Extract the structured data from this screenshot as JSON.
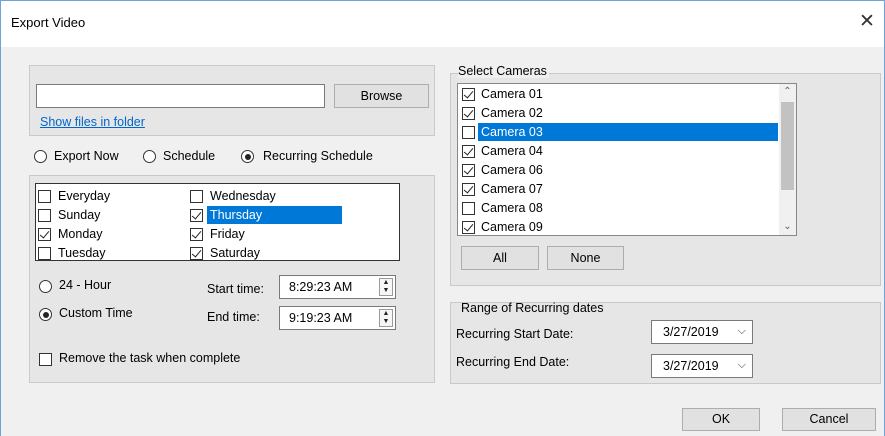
{
  "window": {
    "title": "Export Video",
    "close_glyph": "✕"
  },
  "file": {
    "path_value": "",
    "browse_label": "Browse",
    "show_files_link": "Show files in folder"
  },
  "export_mode": {
    "options": [
      "Export Now",
      "Schedule",
      "Recurring Schedule"
    ],
    "selected": "Recurring Schedule"
  },
  "days": [
    {
      "label": "Everyday",
      "checked": false,
      "selected": false
    },
    {
      "label": "Sunday",
      "checked": false,
      "selected": false
    },
    {
      "label": "Monday",
      "checked": true,
      "selected": false
    },
    {
      "label": "Tuesday",
      "checked": false,
      "selected": false
    },
    {
      "label": "Wednesday",
      "checked": false,
      "selected": false
    },
    {
      "label": "Thursday",
      "checked": true,
      "selected": true
    },
    {
      "label": "Friday",
      "checked": true,
      "selected": false
    },
    {
      "label": "Saturday",
      "checked": true,
      "selected": false
    }
  ],
  "time_mode": {
    "options": [
      "24 - Hour",
      "Custom Time"
    ],
    "selected": "Custom Time"
  },
  "start_time": {
    "label": "Start time:",
    "value": "8:29:23 AM"
  },
  "end_time": {
    "label": "End time:",
    "value": "9:19:23 AM"
  },
  "remove_task": {
    "label": "Remove the task when complete",
    "checked": false
  },
  "cameras": {
    "heading": "Select Cameras",
    "items": [
      {
        "label": "Camera 01",
        "checked": true,
        "selected": false
      },
      {
        "label": "Camera 02",
        "checked": true,
        "selected": false
      },
      {
        "label": "Camera 03",
        "checked": false,
        "selected": true
      },
      {
        "label": "Camera 04",
        "checked": true,
        "selected": false
      },
      {
        "label": "Camera 06",
        "checked": true,
        "selected": false
      },
      {
        "label": "Camera 07",
        "checked": true,
        "selected": false
      },
      {
        "label": "Camera 08",
        "checked": false,
        "selected": false
      },
      {
        "label": "Camera 09",
        "checked": true,
        "selected": false
      }
    ],
    "all_label": "All",
    "none_label": "None"
  },
  "recurring_dates": {
    "heading": "Range of Recurring dates",
    "start_label": "Recurring Start Date:",
    "start_value": "3/27/2019",
    "end_label": "Recurring End Date:",
    "end_value": "3/27/2019"
  },
  "footer": {
    "ok_label": "OK",
    "cancel_label": "Cancel"
  },
  "colors": {
    "selection": "#0078d7",
    "link": "#0066cc",
    "window_border": "#6fa3d6"
  }
}
